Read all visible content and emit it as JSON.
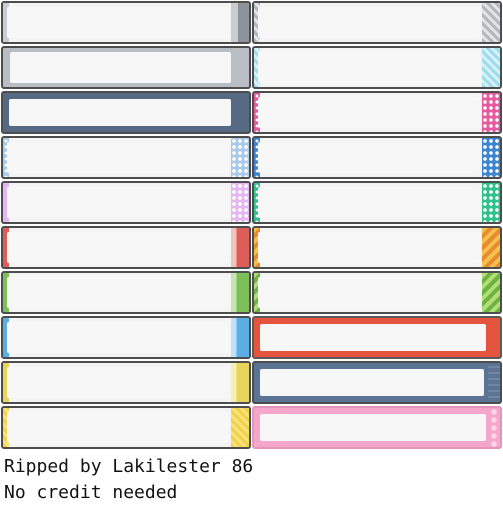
{
  "credits": {
    "line1": "Ripped by Lakilester 86",
    "line2": "No credit needed"
  },
  "colors": {
    "left": [
      "#8d939b",
      "#b9bec4",
      "#566983",
      "#a9c9e7",
      "#e3b7ef",
      "#dd5e58",
      "#7cbf58",
      "#5aaee4",
      "#e7d45c",
      "#f2d24a"
    ],
    "right": [
      "#b4b8bd",
      "#9fdcec",
      "#e55a9e",
      "#3d86cf",
      "#2fc28b",
      "#e88a33",
      "#6cb43e",
      "#e4543e",
      "#5c7494",
      "#f4a6cb"
    ]
  }
}
